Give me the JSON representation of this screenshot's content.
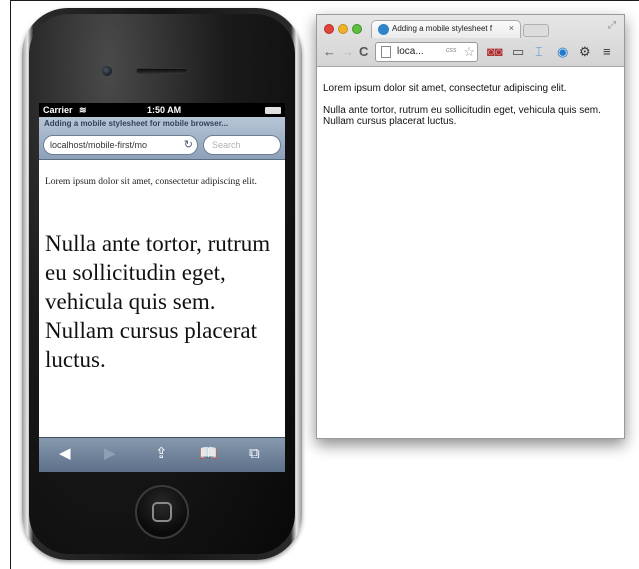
{
  "iphone": {
    "status": {
      "carrier": "Carrier",
      "time": "1:50 AM"
    },
    "safari": {
      "title": "Adding a mobile stylesheet for mobile browser...",
      "url": "localhost/mobile-first/mo",
      "search_placeholder": "Search"
    },
    "content": {
      "small": "Lorem ipsum dolor sit amet, consectetur adipiscing elit.",
      "large": "Nulla ante tortor, rutrum eu sollicitudin eget, vehicula quis sem. Nullam cursus placerat luctus."
    },
    "toolbar": {
      "back": "◀",
      "forward": "▶",
      "share": "⇪",
      "bookmarks": "📖",
      "tabs": "⧉"
    }
  },
  "chrome": {
    "tab_title": "Adding a mobile stylesheet f",
    "tab_close": "×",
    "omnibox_text": "loca...",
    "omnibox_css": "css",
    "content": {
      "p1": "Lorem ipsum dolor sit amet, consectetur adipiscing elit.",
      "p2": "Nulla ante tortor, rutrum eu sollicitudin eget, vehicula quis sem. Nullam cursus placerat luctus."
    }
  },
  "colors": {
    "safari_bar": "#a3b3c7",
    "tab_favicon": "#2f83c8",
    "traffic_red": "#e0443a",
    "traffic_yellow": "#efb32b",
    "traffic_green": "#5fbd3f"
  }
}
